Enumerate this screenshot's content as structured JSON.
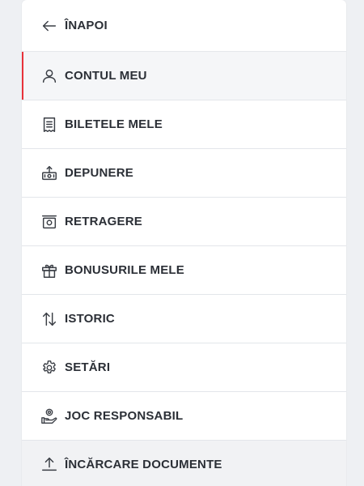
{
  "menu": {
    "back_label": "ÎNAPOI",
    "items": [
      {
        "label": "CONTUL MEU",
        "icon": "user-icon",
        "active": true
      },
      {
        "label": "BILETELE MELE",
        "icon": "receipt-icon"
      },
      {
        "label": "DEPUNERE",
        "icon": "deposit-icon"
      },
      {
        "label": "RETRAGERE",
        "icon": "withdraw-icon"
      },
      {
        "label": "BONUSURILE MELE",
        "icon": "gift-icon"
      },
      {
        "label": "ISTORIC",
        "icon": "sort-arrows-icon"
      },
      {
        "label": "SETĂRI",
        "icon": "gear-icon"
      },
      {
        "label": "JOC RESPONSABIL",
        "icon": "responsible-gaming-icon"
      },
      {
        "label": "ÎNCĂRCARE DOCUMENTE",
        "icon": "upload-icon"
      }
    ]
  },
  "colors": {
    "active_indicator": "#e8323a",
    "background": "#eef0f3",
    "panel": "#ffffff",
    "text": "#2b2f36"
  }
}
